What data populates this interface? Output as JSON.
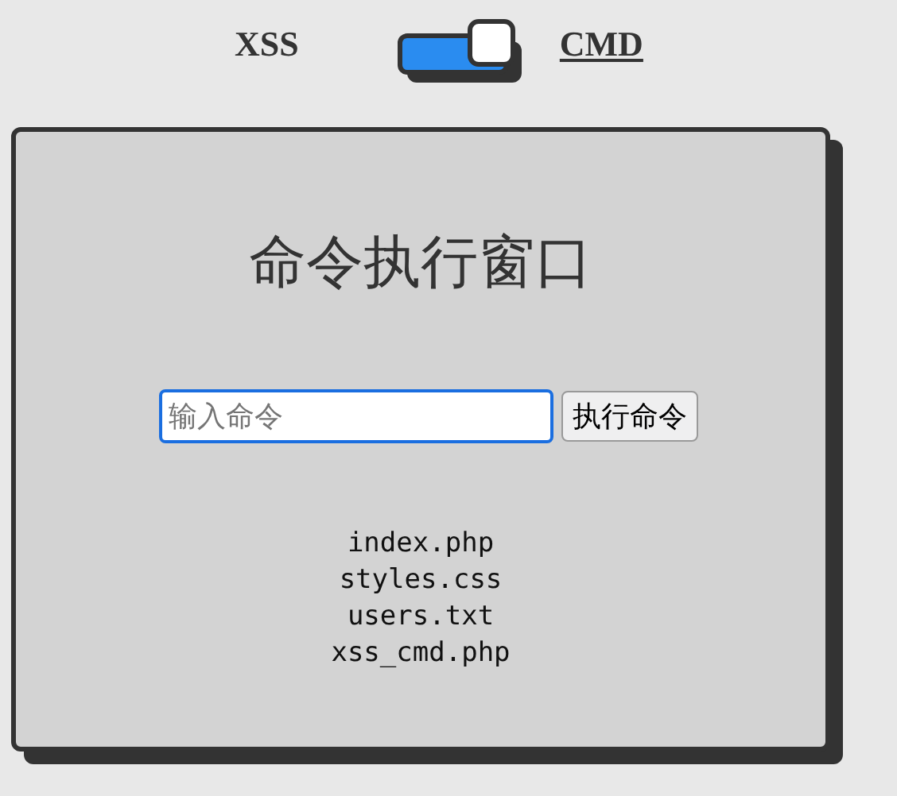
{
  "mode_switch": {
    "on": true,
    "options": [
      {
        "label": "XSS",
        "selected": false
      },
      {
        "label": "CMD",
        "selected": true
      }
    ]
  },
  "panel": {
    "title": "命令执行窗口",
    "command_input": {
      "placeholder": "输入命令"
    },
    "run_button": "执行命令",
    "output": [
      "index.php",
      "styles.css",
      "users.txt",
      "xss_cmd.php"
    ]
  }
}
